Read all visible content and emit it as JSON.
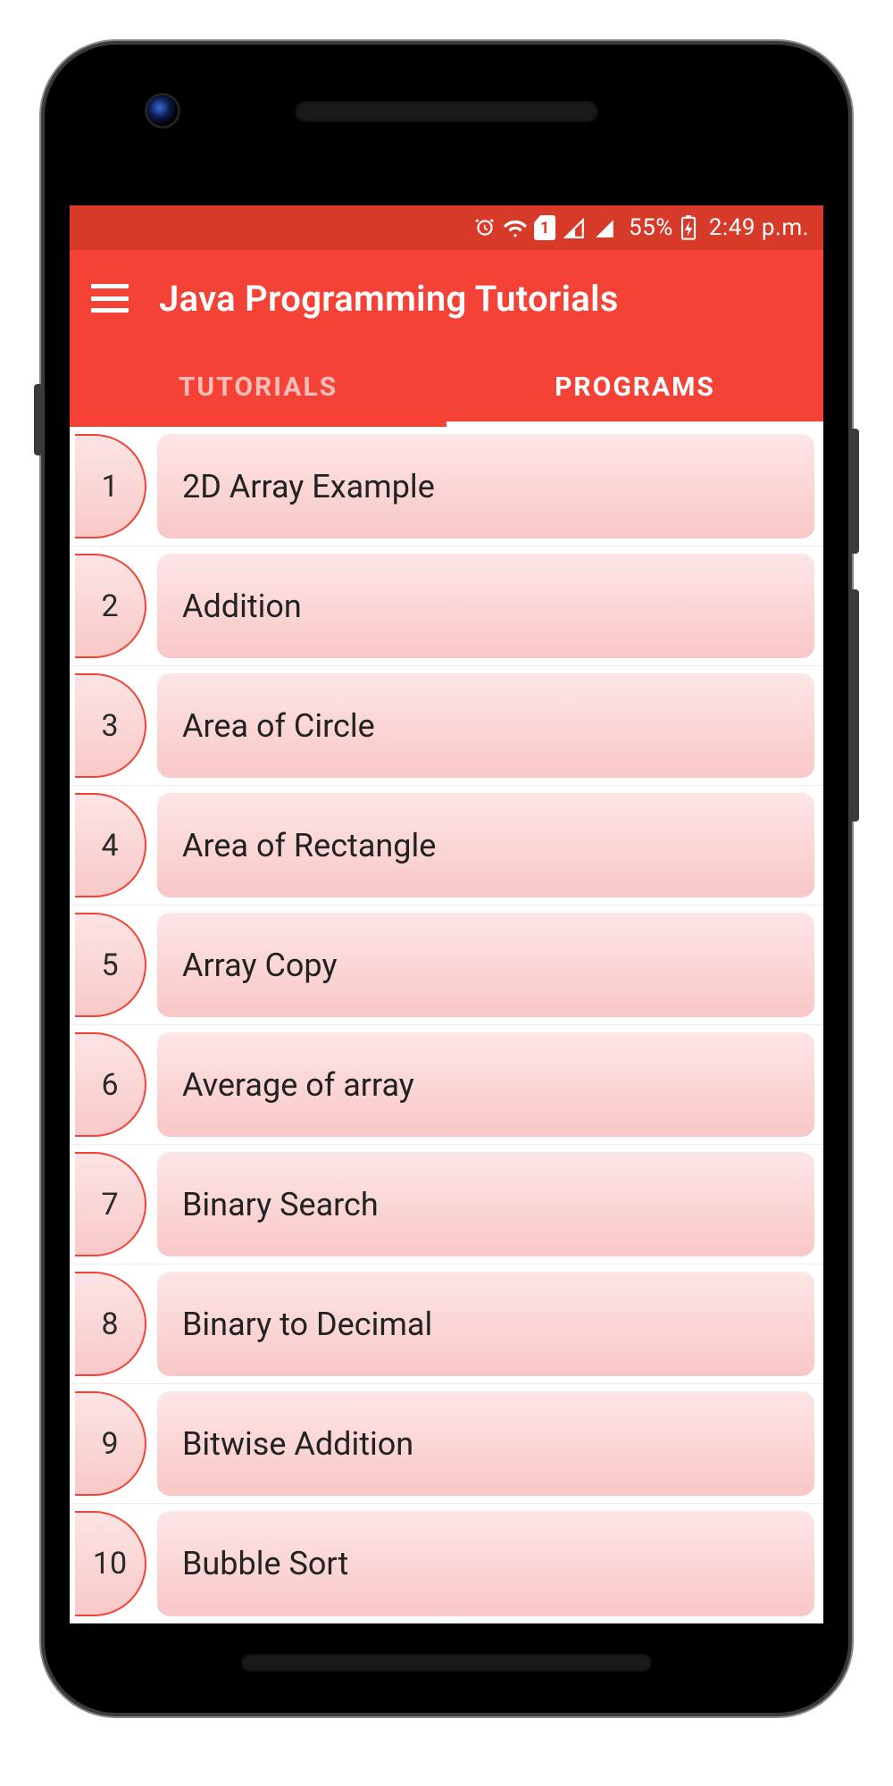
{
  "status": {
    "battery_text": "55%",
    "time_text": "2:49 p.m.",
    "sim_number": "1"
  },
  "app": {
    "title": "Java Programming Tutorials"
  },
  "tabs": {
    "tutorials": "TUTORIALS",
    "programs": "PROGRAMS",
    "active": "programs"
  },
  "colors": {
    "primary": "#f44336",
    "primary_dark": "#d83a2a",
    "pill_border": "#f44336",
    "pill_fill_top": "#fde6e6",
    "pill_fill_bottom": "#f9c7c7"
  },
  "programs": [
    {
      "num": "1",
      "title": "2D Array Example"
    },
    {
      "num": "2",
      "title": "Addition"
    },
    {
      "num": "3",
      "title": "Area of Circle"
    },
    {
      "num": "4",
      "title": "Area of Rectangle"
    },
    {
      "num": "5",
      "title": "Array Copy"
    },
    {
      "num": "6",
      "title": "Average of array"
    },
    {
      "num": "7",
      "title": "Binary Search"
    },
    {
      "num": "8",
      "title": "Binary to Decimal"
    },
    {
      "num": "9",
      "title": "Bitwise Addition"
    },
    {
      "num": "10",
      "title": "Bubble Sort"
    }
  ]
}
